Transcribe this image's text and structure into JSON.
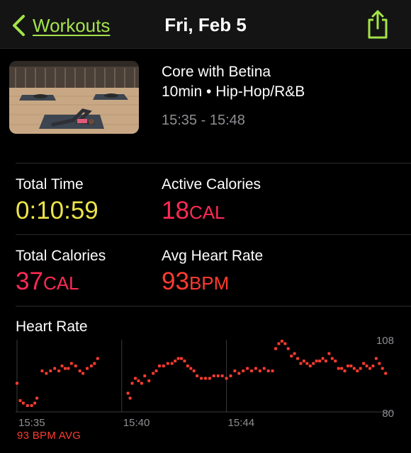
{
  "nav": {
    "back_label": "Workouts",
    "title": "Fri, Feb 5"
  },
  "workout": {
    "title": "Core with Betina",
    "duration_label": "10min",
    "separator": "•",
    "genre": "Hip-Hop/R&B",
    "time_range": "15:35 - 15:48"
  },
  "stats": {
    "total_time": {
      "label": "Total Time",
      "value": "0:10:59"
    },
    "active_calories": {
      "label": "Active Calories",
      "value": "18",
      "unit": "CAL"
    },
    "total_calories": {
      "label": "Total Calories",
      "value": "37",
      "unit": "CAL"
    },
    "avg_heart_rate": {
      "label": "Avg Heart Rate",
      "value": "93",
      "unit": "BPM"
    }
  },
  "heart_rate": {
    "title": "Heart Rate",
    "avg_label": "93 BPM AVG",
    "colors": {
      "point": "#ff3b30",
      "grid": "#3a3a3c",
      "axis_text": "#8e8e93"
    }
  },
  "chart_data": {
    "type": "scatter",
    "title": "Heart Rate",
    "x_ticks": [
      "15:35",
      "15:40",
      "15:44"
    ],
    "y_ticks": [
      108,
      80
    ],
    "ylim": [
      80,
      108
    ],
    "xlim": [
      0,
      13
    ],
    "x_unit": "minutes since 15:35",
    "grid": true,
    "series": [
      {
        "values": [
          [
            0.0,
            91
          ],
          [
            0.15,
            84
          ],
          [
            0.3,
            83
          ],
          [
            0.5,
            82
          ],
          [
            0.7,
            82
          ],
          [
            0.85,
            83
          ],
          [
            0.95,
            85
          ],
          [
            1.2,
            96
          ],
          [
            1.4,
            95
          ],
          [
            1.6,
            96
          ],
          [
            1.8,
            97
          ],
          [
            2.0,
            96
          ],
          [
            2.15,
            98
          ],
          [
            2.3,
            97
          ],
          [
            2.45,
            97
          ],
          [
            2.6,
            99
          ],
          [
            2.8,
            98
          ],
          [
            3.0,
            96
          ],
          [
            3.15,
            95
          ],
          [
            3.35,
            97
          ],
          [
            3.55,
            98
          ],
          [
            3.7,
            99
          ],
          [
            3.85,
            101
          ],
          [
            5.3,
            87
          ],
          [
            5.4,
            85
          ],
          [
            5.5,
            91
          ],
          [
            5.65,
            93
          ],
          [
            5.8,
            92
          ],
          [
            5.95,
            91
          ],
          [
            6.1,
            94
          ],
          [
            6.3,
            92
          ],
          [
            6.5,
            95
          ],
          [
            6.65,
            96
          ],
          [
            6.8,
            98
          ],
          [
            7.0,
            98
          ],
          [
            7.2,
            99
          ],
          [
            7.4,
            99
          ],
          [
            7.55,
            100
          ],
          [
            7.7,
            101
          ],
          [
            7.85,
            101
          ],
          [
            8.0,
            100
          ],
          [
            8.15,
            98
          ],
          [
            8.3,
            97
          ],
          [
            8.45,
            96
          ],
          [
            8.6,
            94
          ],
          [
            8.8,
            93
          ],
          [
            9.0,
            93
          ],
          [
            9.2,
            93
          ],
          [
            9.4,
            94
          ],
          [
            9.6,
            94
          ],
          [
            9.8,
            94
          ],
          [
            10.0,
            93
          ],
          [
            10.2,
            94
          ],
          [
            10.4,
            96
          ],
          [
            10.6,
            95
          ],
          [
            10.8,
            96
          ],
          [
            11.0,
            97
          ],
          [
            11.2,
            96
          ],
          [
            11.4,
            97
          ],
          [
            11.6,
            96
          ],
          [
            11.8,
            97
          ],
          [
            12.0,
            96
          ],
          [
            12.2,
            96
          ],
          [
            12.35,
            105
          ],
          [
            12.5,
            107
          ],
          [
            12.65,
            108
          ],
          [
            12.8,
            107
          ],
          [
            12.95,
            105
          ],
          [
            13.1,
            102
          ],
          [
            13.25,
            103
          ],
          [
            13.4,
            101
          ],
          [
            13.55,
            99
          ],
          [
            13.7,
            100
          ],
          [
            13.85,
            99
          ],
          [
            14.0,
            98
          ],
          [
            14.15,
            99
          ],
          [
            14.3,
            100
          ],
          [
            14.45,
            100
          ],
          [
            14.6,
            101
          ],
          [
            14.75,
            100
          ],
          [
            14.9,
            103
          ],
          [
            15.05,
            101
          ],
          [
            15.2,
            100
          ],
          [
            15.35,
            97
          ],
          [
            15.5,
            97
          ],
          [
            15.65,
            96
          ],
          [
            15.8,
            98
          ],
          [
            15.95,
            98
          ],
          [
            16.1,
            97
          ],
          [
            16.25,
            96
          ],
          [
            16.4,
            97
          ],
          [
            16.55,
            99
          ],
          [
            16.7,
            98
          ],
          [
            16.85,
            97
          ],
          [
            17.0,
            98
          ],
          [
            17.15,
            101
          ],
          [
            17.3,
            99
          ],
          [
            17.45,
            97
          ],
          [
            17.6,
            95
          ]
        ]
      }
    ]
  }
}
